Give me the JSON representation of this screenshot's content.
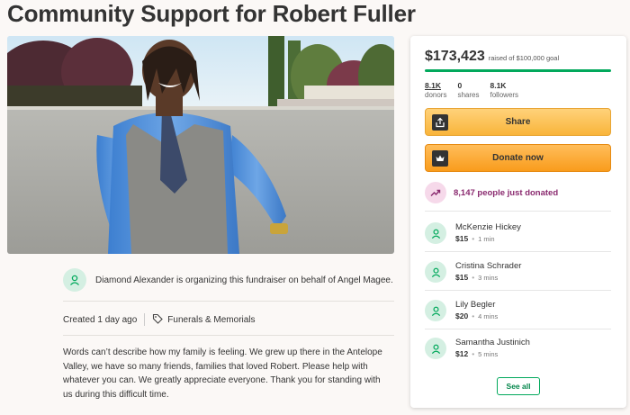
{
  "page": {
    "title": "Community Support for Robert Fuller"
  },
  "organizer": {
    "text": "Diamond Alexander is organizing this fundraiser on behalf of Angel Magee."
  },
  "meta": {
    "created": "Created 1 day ago",
    "category": "Funerals & Memorials"
  },
  "story": {
    "text": "Words can’t describe how my family is feeling. We grew up there in the Antelope Valley, we have so many friends, families that loved Robert. Please help with whatever you can. We greatly appreciate everyone. Thank you for standing with us during this difficult time."
  },
  "donation_card": {
    "raised": "$173,423",
    "goal_text": "raised of $100,000 goal",
    "progress_fraction": 1.0,
    "stats": [
      {
        "value": "8.1K",
        "label": "donors"
      },
      {
        "value": "0",
        "label": "shares"
      },
      {
        "value": "8.1K",
        "label": "followers"
      }
    ],
    "share_label": "Share",
    "donate_label": "Donate now",
    "trending_text": "8,147 people just donated",
    "donors": [
      {
        "name": "McKenzie Hickey",
        "amount": "$15",
        "time": "1 min"
      },
      {
        "name": "Cristina Schrader",
        "amount": "$15",
        "time": "3 mins"
      },
      {
        "name": "Lily Begler",
        "amount": "$20",
        "time": "4 mins"
      },
      {
        "name": "Samantha Justinich",
        "amount": "$12",
        "time": "5 mins"
      }
    ],
    "see_all_label": "See all"
  },
  "colors": {
    "accent_green": "#02a95c",
    "trend_purple": "#8a2a6f",
    "button_orange": "#f99c1c"
  },
  "icons": [
    "person-icon",
    "tag-icon",
    "share-upload-icon",
    "gofundme-logo-icon",
    "trending-up-icon"
  ]
}
